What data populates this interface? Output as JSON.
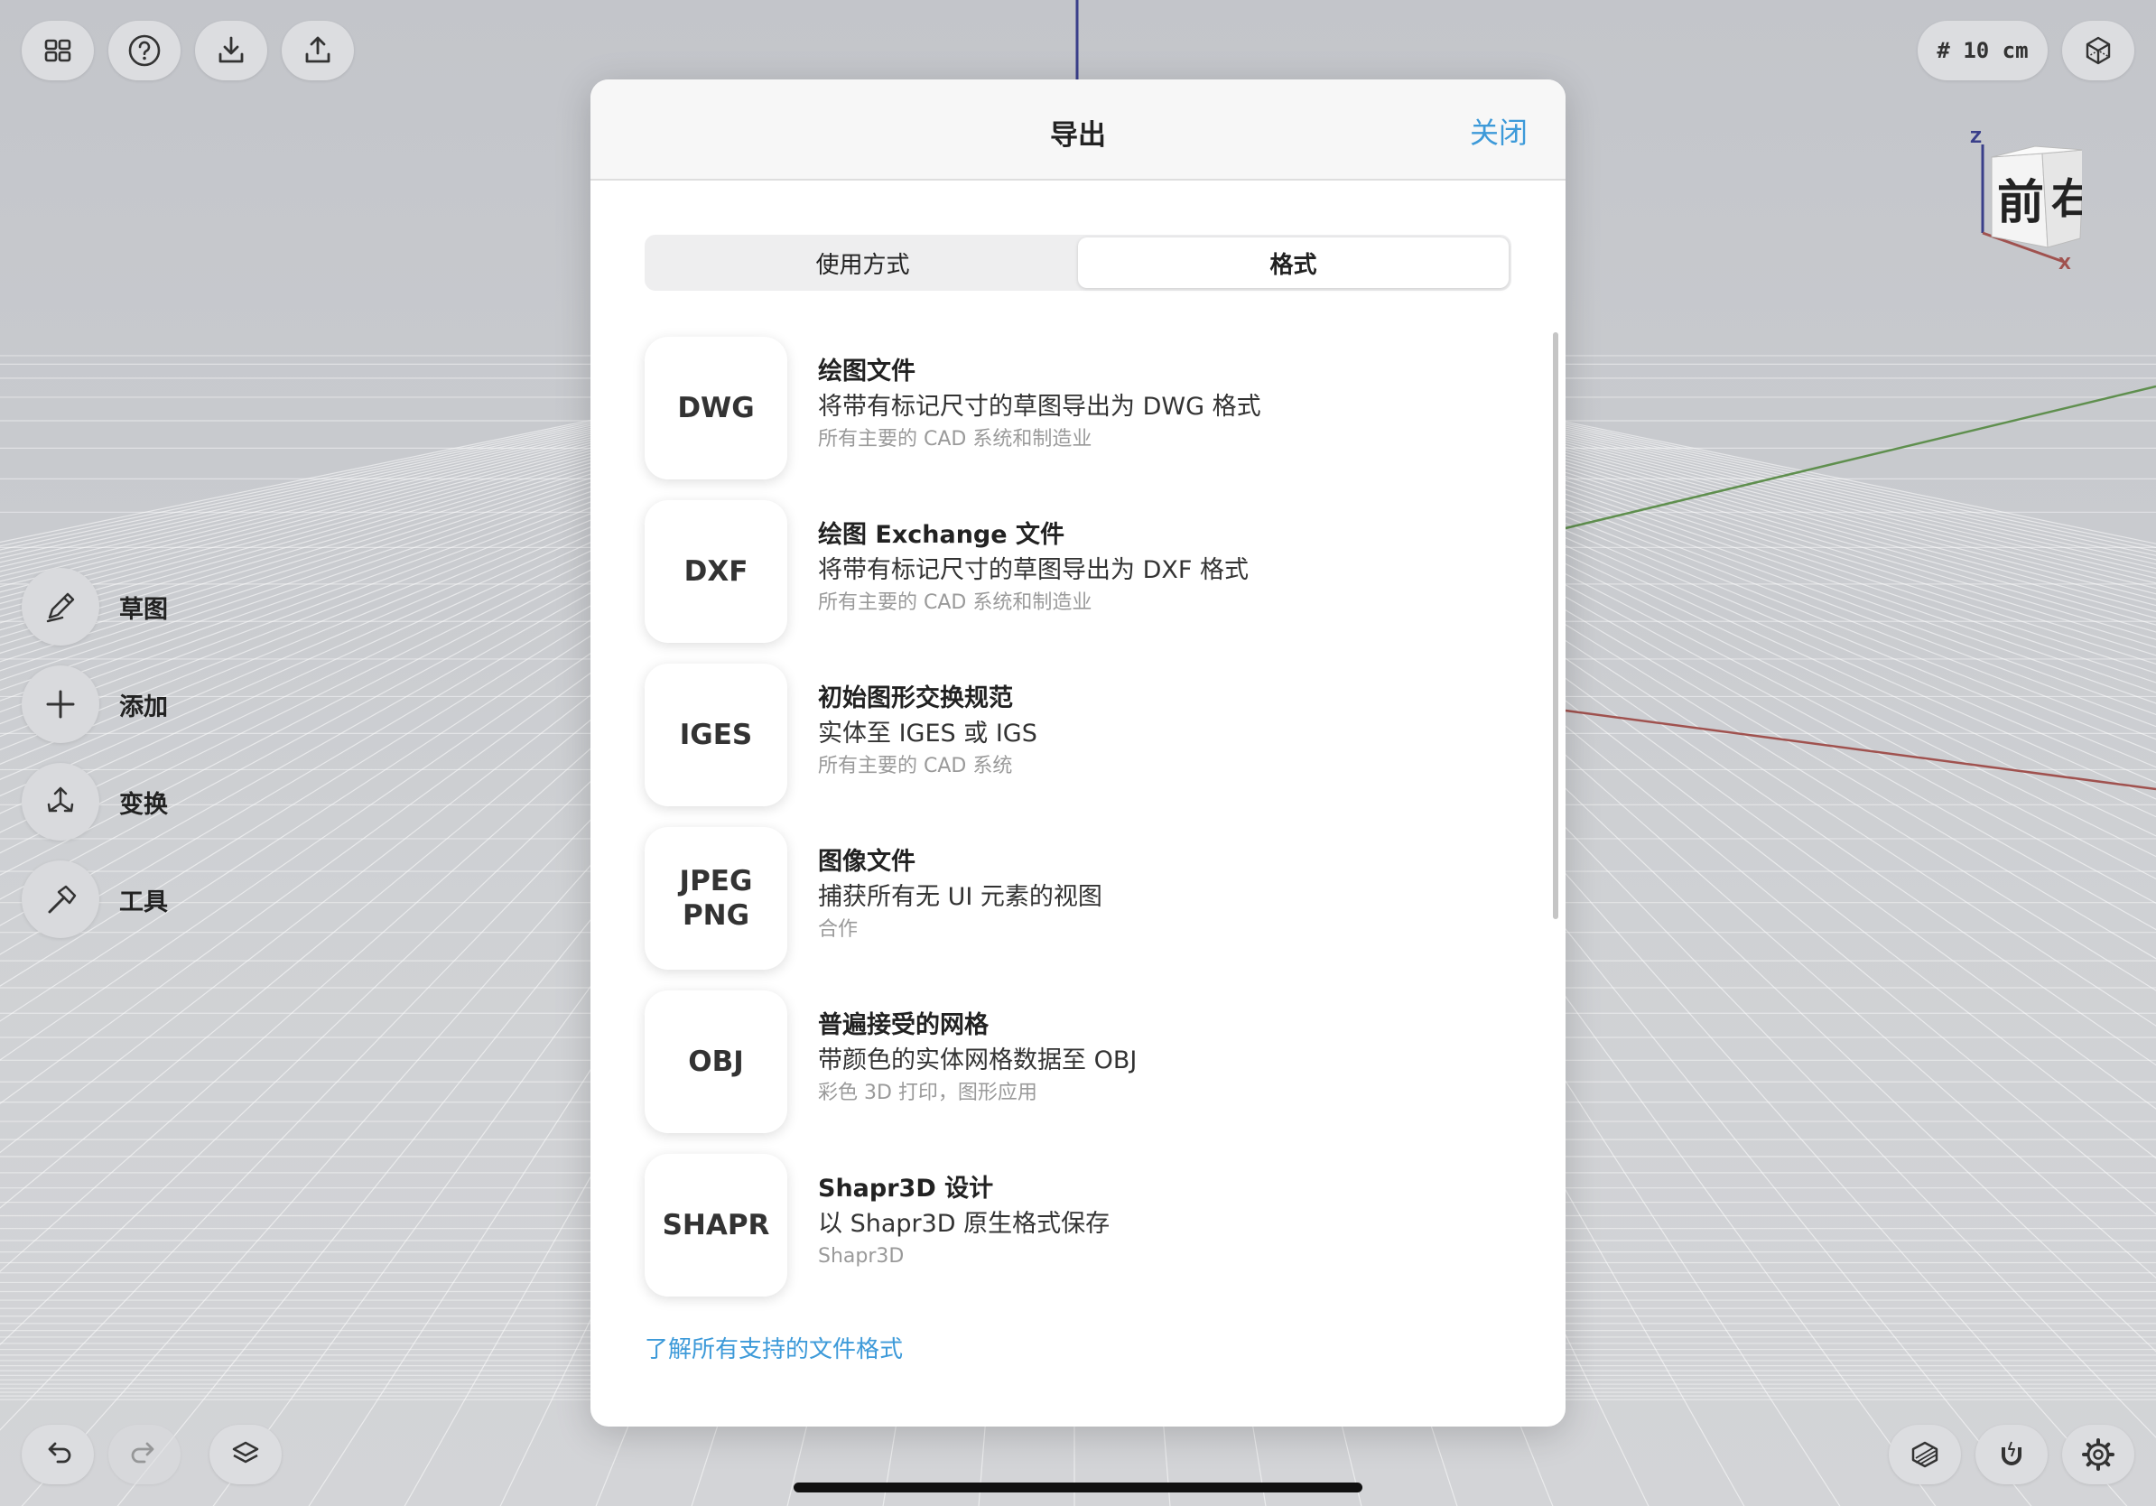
{
  "top_toolbar": {
    "grid_icon": "grid-icon",
    "help_icon": "help-icon",
    "import_icon": "import-icon",
    "export_icon": "export-icon",
    "unit_label": "# 10 cm",
    "view_icon": "cube-view-icon"
  },
  "view_cube": {
    "front": "前",
    "right": "右",
    "z_axis": "Z",
    "x_axis": "X"
  },
  "tools": [
    {
      "label": "草图",
      "icon": "sketch-pen-icon"
    },
    {
      "label": "添加",
      "icon": "plus-icon"
    },
    {
      "label": "变换",
      "icon": "transform-icon"
    },
    {
      "label": "工具",
      "icon": "hammer-icon"
    }
  ],
  "dialog": {
    "title": "导出",
    "close_label": "关闭",
    "tabs": [
      {
        "label": "使用方式",
        "active": false
      },
      {
        "label": "格式",
        "active": true
      }
    ],
    "formats": [
      {
        "tile": "DWG",
        "title": "绘图文件",
        "desc": "将带有标记尺寸的草图导出为 DWG 格式",
        "sub": "所有主要的 CAD 系统和制造业"
      },
      {
        "tile": "DXF",
        "title": "绘图 Exchange 文件",
        "desc": "将带有标记尺寸的草图导出为 DXF 格式",
        "sub": "所有主要的 CAD 系统和制造业"
      },
      {
        "tile": "IGES",
        "title": "初始图形交换规范",
        "desc": "实体至 IGES 或 IGS",
        "sub": "所有主要的 CAD 系统"
      },
      {
        "tile": "JPEG\nPNG",
        "title": "图像文件",
        "desc": "捕获所有无 UI 元素的视图",
        "sub": "合作"
      },
      {
        "tile": "OBJ",
        "title": "普遍接受的网格",
        "desc": "带颜色的实体网格数据至 OBJ",
        "sub": "彩色 3D 打印，图形应用"
      },
      {
        "tile": "SHAPR",
        "title": "Shapr3D 设计",
        "desc": "以 Shapr3D 原生格式保存",
        "sub": "Shapr3D"
      }
    ],
    "learn_more": "了解所有支持的文件格式"
  },
  "bottom_toolbar": {
    "undo_icon": "undo-icon",
    "redo_icon": "redo-icon",
    "layers_icon": "layers-icon",
    "section_icon": "section-view-icon",
    "snap_icon": "magnet-icon",
    "settings_icon": "gear-icon"
  },
  "colors": {
    "accent": "#3d9ad9",
    "axis_x": "#a0524f",
    "axis_y": "#5f8f4e",
    "axis_z": "#3a3f8a"
  }
}
